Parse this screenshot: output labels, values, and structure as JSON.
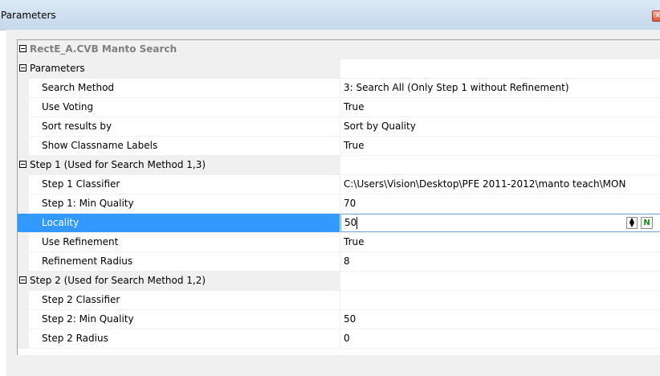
{
  "window": {
    "title": "Parameters",
    "close_icon": "close-icon"
  },
  "grid": {
    "root": {
      "label": "RectE_A.CVB Manto Search"
    },
    "categories": [
      {
        "label": "Parameters",
        "properties": [
          {
            "name": "Search Method",
            "value": "3: Search All    (Only Step 1 without Refinement)"
          },
          {
            "name": "Use Voting",
            "value": "True"
          },
          {
            "name": "Sort results by",
            "value": "Sort by Quality"
          },
          {
            "name": "Show Classname Labels",
            "value": "True"
          }
        ]
      },
      {
        "label": "Step 1 (Used for Search Method 1,3)",
        "properties": [
          {
            "name": "Step 1 Classifier",
            "value": "C:\\Users\\Vision\\Desktop\\PFE 2011-2012\\manto teach\\MON"
          },
          {
            "name": "Step 1: Min Quality",
            "value": "70"
          },
          {
            "name": "Locality",
            "value": "50",
            "selected": true
          },
          {
            "name": "Use Refinement",
            "value": "True"
          },
          {
            "name": "Refinement Radius",
            "value": "8"
          }
        ]
      },
      {
        "label": "Step 2 (Used for Search Method 1,2)",
        "properties": [
          {
            "name": "Step 2 Classifier",
            "value": ""
          },
          {
            "name": "Step 2: Min Quality",
            "value": "50"
          },
          {
            "name": "Step 2 Radius",
            "value": "0"
          }
        ]
      }
    ],
    "editor_buttons": {
      "spin_icon": "spin-icon",
      "n_label": "N"
    }
  }
}
